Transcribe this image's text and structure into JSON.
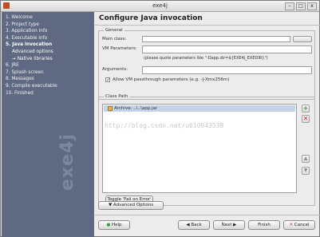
{
  "window": {
    "title": "exe4j",
    "controls": [
      "–",
      "□",
      "x"
    ]
  },
  "steps": [
    {
      "label": "1. Welcome",
      "indent": false,
      "state": "done"
    },
    {
      "label": "2. Project type",
      "indent": false,
      "state": "done"
    },
    {
      "label": "3. Application info",
      "indent": false,
      "state": "done"
    },
    {
      "label": "4. Executable info",
      "indent": false,
      "state": "done"
    },
    {
      "label": "5. Java invocation",
      "indent": false,
      "state": "current"
    },
    {
      "label": "Advanced options",
      "indent": true,
      "state": "sub"
    },
    {
      "label": "→ Native libraries",
      "indent": true,
      "state": "sub"
    },
    {
      "label": "6. JRE",
      "indent": false,
      "state": "todo"
    },
    {
      "label": "7. Splash screen",
      "indent": false,
      "state": "todo"
    },
    {
      "label": "8. Messages",
      "indent": false,
      "state": "todo"
    },
    {
      "label": "9. Compile executable",
      "indent": false,
      "state": "todo"
    },
    {
      "label": "10. Finished",
      "indent": false,
      "state": "todo"
    }
  ],
  "brand": "exe4j",
  "main": {
    "title": "Configure Java invocation",
    "general": {
      "label": "General",
      "main_class_label": "Main class:",
      "main_class_value": "",
      "vm_params_label": "VM Parameters:",
      "vm_params_value": "",
      "vm_hint": "(please quote parameters like \"-Dapp.dir=${EXE4J_EXEDIR}\")",
      "arguments_label": "Arguments:",
      "arguments_value": "",
      "allow_passthrough_label": "Allow VM passthrough parameters (e.g. -J-Xmx256m)",
      "allow_passthrough_checked": true
    },
    "class_path": {
      "label": "Class Path",
      "items": [
        {
          "label": "Archive: ..\\..\\app.jar",
          "selected": true
        }
      ],
      "toggle_button": "Toggle 'Fail on Error'"
    },
    "advanced_button": "Advanced Options"
  },
  "watermark": "http://blog.csdn.net/u010043538",
  "footer": {
    "help": "Help",
    "back": "Back",
    "next": "Next",
    "finish": "Finish",
    "cancel": "Cancel"
  },
  "colors": {
    "step_panel": "#5f6a82",
    "selection": "#c5d2ea",
    "add_icon": "#3a9a3a",
    "remove_icon": "#cc2a2a"
  }
}
